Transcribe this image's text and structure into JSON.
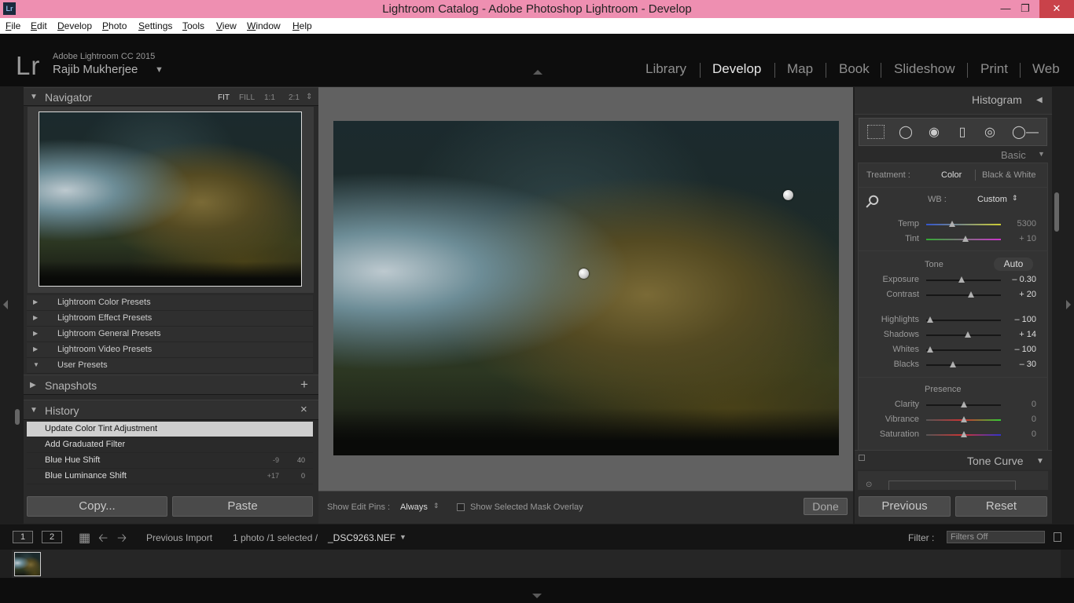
{
  "window": {
    "title": "Lightroom Catalog - Adobe Photoshop Lightroom - Develop",
    "icon_label": "Lr"
  },
  "menu": [
    "File",
    "Edit",
    "Develop",
    "Photo",
    "Settings",
    "Tools",
    "View",
    "Window",
    "Help"
  ],
  "identity": {
    "logo": "Lr",
    "product": "Adobe Lightroom CC 2015",
    "user": "Rajib Mukherjee"
  },
  "modules": [
    "Library",
    "Develop",
    "Map",
    "Book",
    "Slideshow",
    "Print",
    "Web"
  ],
  "active_module": "Develop",
  "navigator": {
    "title": "Navigator",
    "options": [
      "FIT",
      "FILL",
      "1:1",
      "2:1"
    ]
  },
  "presets": [
    "Lightroom Color Presets",
    "Lightroom Effect Presets",
    "Lightroom General Presets",
    "Lightroom Video Presets",
    "User Presets"
  ],
  "snapshots": {
    "title": "Snapshots",
    "add": "+"
  },
  "history": {
    "title": "History",
    "clear": "×",
    "items": [
      {
        "label": "Update Color Tint Adjustment",
        "v1": "",
        "v2": "",
        "selected": true
      },
      {
        "label": "Add Graduated Filter",
        "v1": "",
        "v2": ""
      },
      {
        "label": "Blue Hue Shift",
        "v1": "-9",
        "v2": "40"
      },
      {
        "label": "Blue Luminance Shift",
        "v1": "+17",
        "v2": "0"
      }
    ]
  },
  "left_buttons": {
    "copy": "Copy...",
    "paste": "Paste"
  },
  "toolbar": {
    "show_edit_pins_label": "Show Edit Pins :",
    "show_edit_pins_value": "Always",
    "mask_overlay_label": "Show Selected Mask Overlay",
    "done": "Done"
  },
  "right": {
    "histogram": "Histogram",
    "basic": "Basic",
    "treatment_label": "Treatment :",
    "treatment_color": "Color",
    "treatment_bw": "Black & White",
    "wb_label": "WB :",
    "wb_value": "Custom",
    "tone_label": "Tone",
    "auto": "Auto",
    "presence_label": "Presence",
    "tone_curve": "Tone Curve",
    "sliders": [
      {
        "label": "Temp",
        "value": "5300",
        "pos": 0.35
      },
      {
        "label": "Tint",
        "value": "+ 10",
        "pos": 0.53
      },
      {
        "label": "Exposure",
        "value": "– 0.30",
        "pos": 0.47
      },
      {
        "label": "Contrast",
        "value": "+ 20",
        "pos": 0.6
      },
      {
        "label": "Highlights",
        "value": "– 100",
        "pos": 0.05
      },
      {
        "label": "Shadows",
        "value": "+ 14",
        "pos": 0.56
      },
      {
        "label": "Whites",
        "value": "– 100",
        "pos": 0.05
      },
      {
        "label": "Blacks",
        "value": "– 30",
        "pos": 0.36
      },
      {
        "label": "Clarity",
        "value": "0",
        "pos": 0.5
      },
      {
        "label": "Vibrance",
        "value": "0",
        "pos": 0.5
      },
      {
        "label": "Saturation",
        "value": "0",
        "pos": 0.5
      }
    ],
    "previous": "Previous",
    "reset": "Reset"
  },
  "filmstrip": {
    "view1": "1",
    "view2": "2",
    "source": "Previous Import",
    "count": "1 photo /1 selected /",
    "filename": "_DSC9263.NEF",
    "filter_label": "Filter :",
    "filter_value": "Filters Off"
  },
  "colors": {
    "title_bar": "#ee8fb1",
    "panel": "#2a2a2a",
    "header": "#0d0d0d",
    "close_button": "#c9424a"
  }
}
